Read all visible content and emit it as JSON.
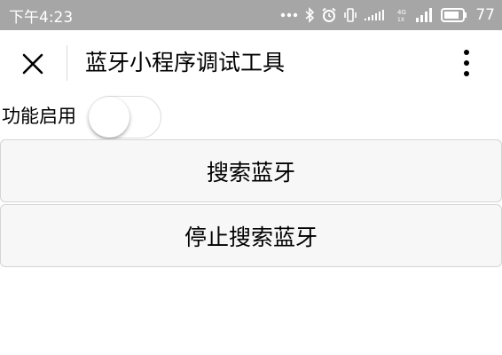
{
  "status_bar": {
    "time": "下午4:23",
    "battery": "77",
    "icons": [
      "more-dots-icon",
      "bluetooth-icon",
      "alarm-icon",
      "vibrate-icon",
      "signal-dots-icon",
      "network-4g-icon",
      "signal-bars-icon",
      "battery-icon"
    ]
  },
  "nav": {
    "title": "蓝牙小程序调试工具",
    "close_icon": "close-icon",
    "more_icon": "more-vertical-icon"
  },
  "toggle": {
    "label": "功能启用",
    "checked": false
  },
  "buttons": {
    "search": "搜索蓝牙",
    "stop": "停止搜索蓝牙"
  }
}
